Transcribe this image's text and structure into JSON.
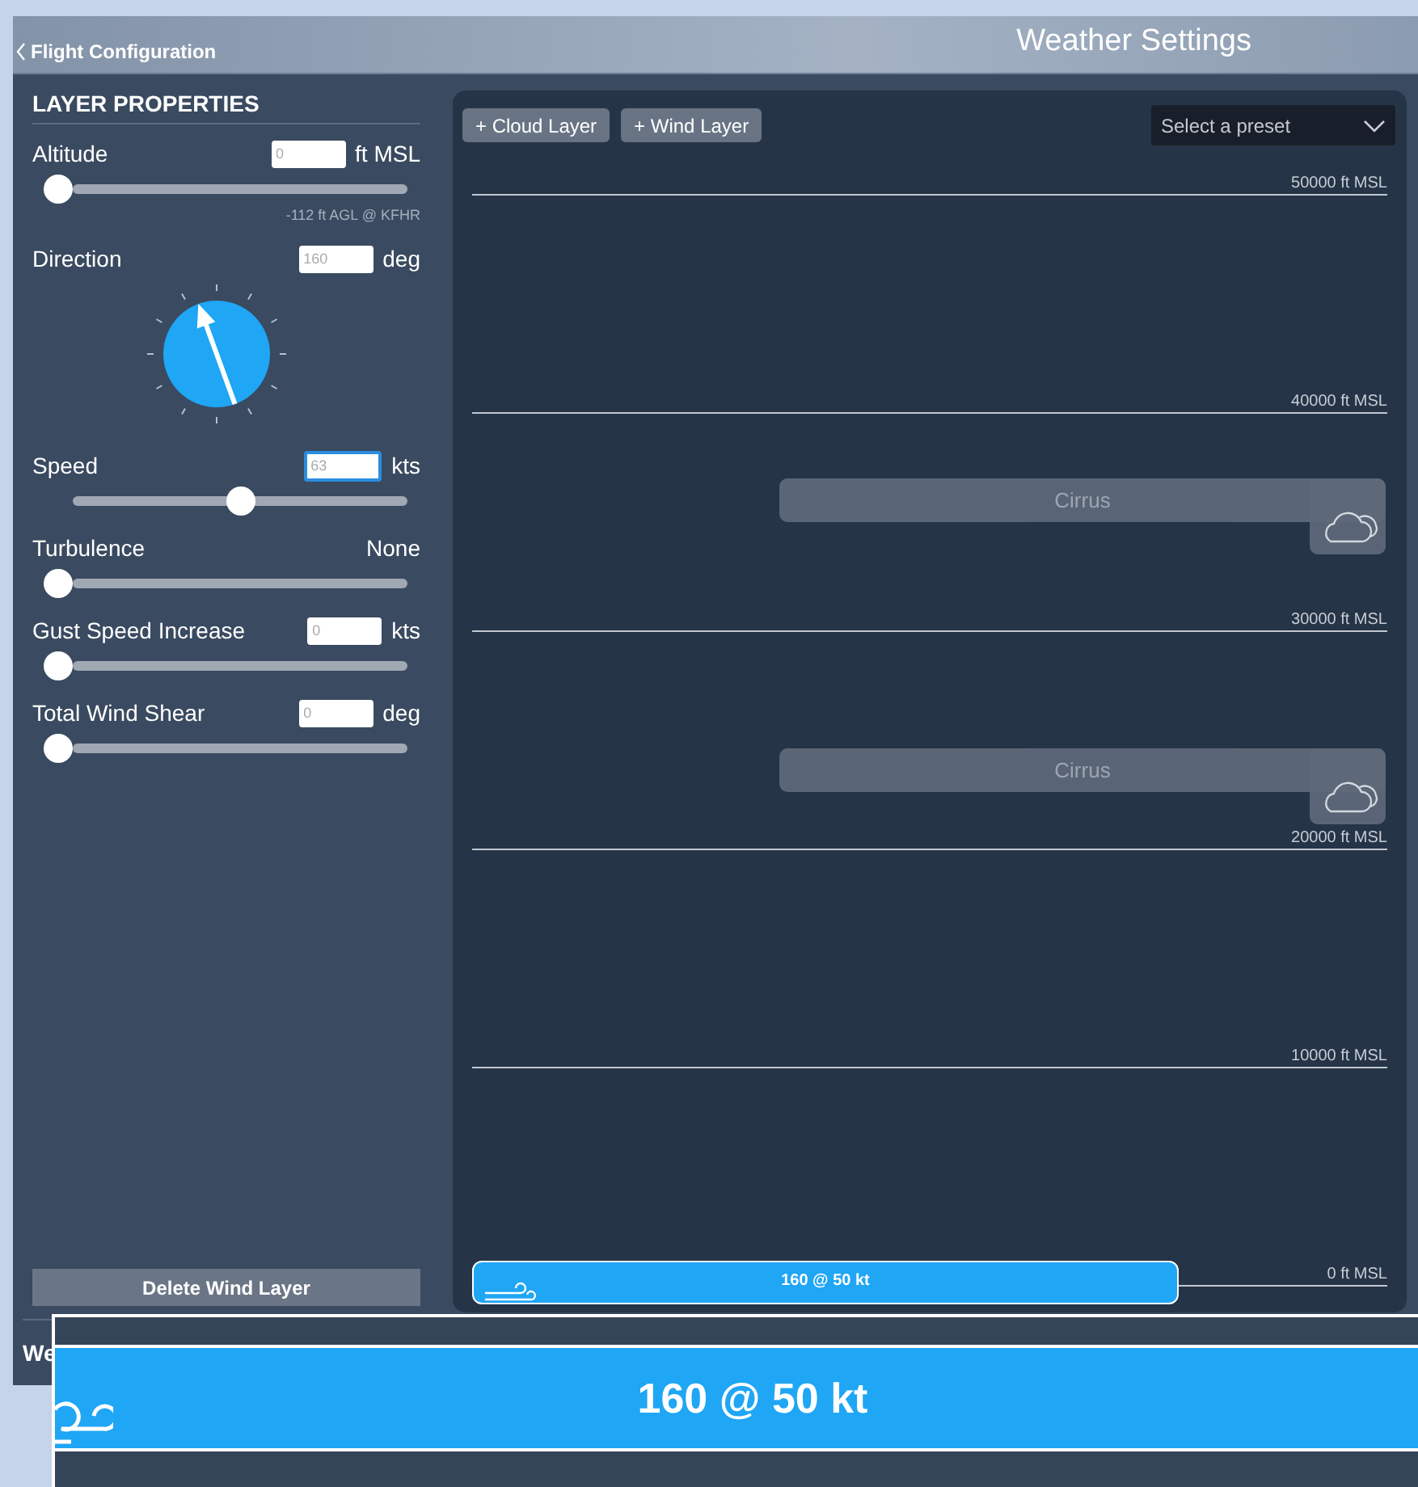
{
  "header": {
    "back_label": "Flight Configuration",
    "title": "Weather Settings"
  },
  "layer_properties": {
    "heading": "LAYER PROPERTIES",
    "rows": [
      {
        "kind": "number",
        "label": "Altitude",
        "value": "0",
        "unit": "ft MSL",
        "level": 0,
        "focused": false,
        "note": "-112 ft AGL @ KFHR"
      },
      {
        "kind": "dial",
        "label": "Direction",
        "value": "160",
        "unit": "deg",
        "focused": false
      },
      {
        "kind": "number",
        "label": "Speed",
        "value": "63",
        "unit": "kts",
        "level": 0.5,
        "focused": true
      },
      {
        "kind": "choice",
        "label": "Turbulence",
        "reading": "None",
        "level": 0
      },
      {
        "kind": "number",
        "label": "Gust Speed Increase",
        "value": "0",
        "unit": "kts",
        "level": 0,
        "focused": false
      },
      {
        "kind": "number",
        "label": "Total Wind Shear",
        "value": "0",
        "unit": "deg",
        "level": 0,
        "focused": false
      }
    ],
    "delete_button": "Delete Wind Layer"
  },
  "timeline": {
    "buttons": [
      "+ Cloud Layer",
      "+ Wind Layer"
    ],
    "preset": {
      "placeholder": "Select a preset"
    },
    "altitudes": [
      "50000 ft MSL",
      "40000 ft MSL",
      "30000 ft MSL",
      "20000 ft MSL",
      "10000 ft MSL",
      "0 ft MSL"
    ],
    "layers": [
      {
        "kind": "cloud",
        "label": "Cirrus"
      },
      {
        "kind": "cloud",
        "label": "Cirrus"
      },
      {
        "kind": "wind",
        "label": "160 @ 50 kt"
      }
    ]
  },
  "bottom_bar": {
    "text": "We"
  },
  "zoom_inset": {
    "label": "160 @ 50 kt"
  }
}
